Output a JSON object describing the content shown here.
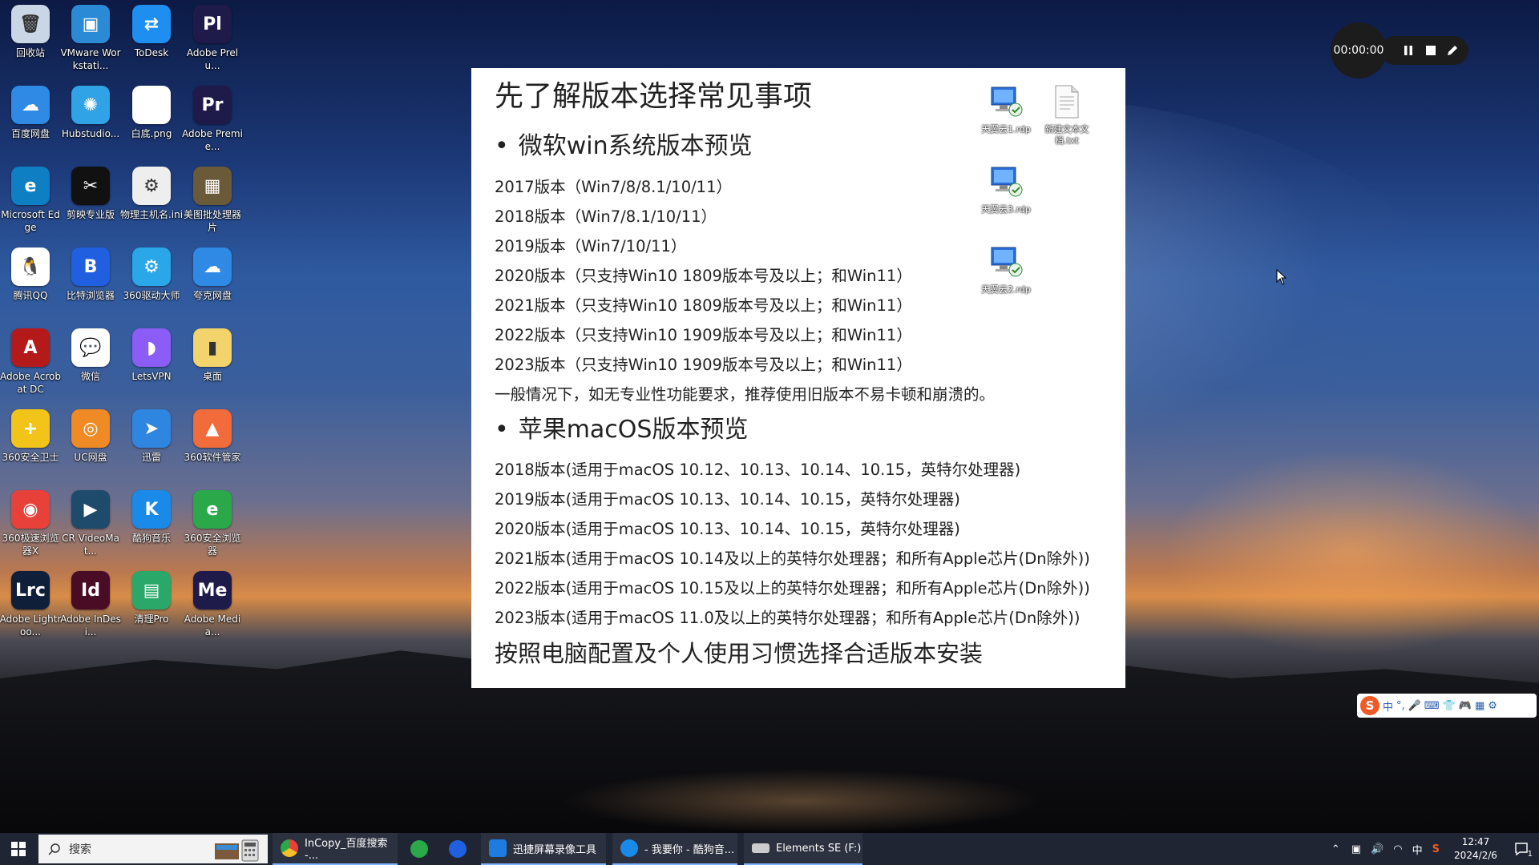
{
  "desktop_icons": [
    {
      "label": "回收站",
      "icon": "recycle-bin-icon",
      "color": "#c9d6e6",
      "glyph": "🗑"
    },
    {
      "label": "VMware Workstati...",
      "icon": "vmware-icon",
      "color": "#2b8ad6",
      "glyph": "▣"
    },
    {
      "label": "ToDesk",
      "icon": "todesk-icon",
      "color": "#1f8ef1",
      "glyph": "⇄"
    },
    {
      "label": "Adobe Prelu...",
      "icon": "adobe-prelude-icon",
      "color": "#1e1b4b",
      "glyph": "Pl"
    },
    {
      "label": "百度网盘",
      "icon": "baidu-netdisk-icon",
      "color": "#2f8ae5",
      "glyph": "☁"
    },
    {
      "label": "Hubstudio...",
      "icon": "hubstudio-icon",
      "color": "#2fa3e6",
      "glyph": "✺"
    },
    {
      "label": "白底.png",
      "icon": "image-file-icon",
      "color": "#ffffff",
      "glyph": ""
    },
    {
      "label": "Adobe Premie...",
      "icon": "adobe-premiere-icon",
      "color": "#1e1b4b",
      "glyph": "Pr"
    },
    {
      "label": "Microsoft Edge",
      "icon": "edge-icon",
      "color": "#0f7fc4",
      "glyph": "e"
    },
    {
      "label": "剪映专业版",
      "icon": "jianying-icon",
      "color": "#111111",
      "glyph": "✂"
    },
    {
      "label": "物理主机名.ini",
      "icon": "ini-file-icon",
      "color": "#eeeeee",
      "glyph": "⚙"
    },
    {
      "label": "美图批处理器片",
      "icon": "meitu-icon",
      "color": "#6b5a3a",
      "glyph": "▦"
    },
    {
      "label": "腾讯QQ",
      "icon": "qq-icon",
      "color": "#ffffff",
      "glyph": "🐧"
    },
    {
      "label": "比特浏览器",
      "icon": "bit-browser-icon",
      "color": "#1f5fe0",
      "glyph": "B"
    },
    {
      "label": "360驱动大师",
      "icon": "driver-master-icon",
      "color": "#2aa7e8",
      "glyph": "⚙"
    },
    {
      "label": "夸克网盘",
      "icon": "quark-netdisk-icon",
      "color": "#2f8ae5",
      "glyph": "☁"
    },
    {
      "label": "Adobe Acrobat DC",
      "icon": "acrobat-icon",
      "color": "#b51a1a",
      "glyph": "A"
    },
    {
      "label": "微信",
      "icon": "wechat-icon",
      "color": "#ffffff",
      "glyph": "💬"
    },
    {
      "label": "LetsVPN",
      "icon": "letsvpn-icon",
      "color": "#8b5cf6",
      "glyph": "◗"
    },
    {
      "label": "桌面",
      "icon": "folder-icon",
      "color": "#f3d36b",
      "glyph": "▮"
    },
    {
      "label": "360安全卫士",
      "icon": "360-security-icon",
      "color": "#f2c41a",
      "glyph": "+"
    },
    {
      "label": "UC网盘",
      "icon": "uc-netdisk-icon",
      "color": "#f08a24",
      "glyph": "◎"
    },
    {
      "label": "迅雷",
      "icon": "xunlei-icon",
      "color": "#2f86e0",
      "glyph": "➤"
    },
    {
      "label": "360软件管家",
      "icon": "360-software-icon",
      "color": "#f26b3a",
      "glyph": "▲"
    },
    {
      "label": "360极速浏览器X",
      "icon": "360-browser-icon",
      "color": "#e8413a",
      "glyph": "◉"
    },
    {
      "label": "CR VideoMat...",
      "icon": "cr-videomate-icon",
      "color": "#1e4a6b",
      "glyph": "▶"
    },
    {
      "label": "酷狗音乐",
      "icon": "kugou-icon",
      "color": "#1a8ae8",
      "glyph": "K"
    },
    {
      "label": "360安全浏览器",
      "icon": "360-safe-browser-icon",
      "color": "#2aa84a",
      "glyph": "e"
    },
    {
      "label": "Adobe Lightroo...",
      "icon": "lightroom-icon",
      "color": "#0f1f3a",
      "glyph": "Lrc"
    },
    {
      "label": "Adobe InDesi...",
      "icon": "indesign-icon",
      "color": "#4a0b24",
      "glyph": "Id"
    },
    {
      "label": "清理Pro",
      "icon": "cleaner-pro-icon",
      "color": "#2aa86a",
      "glyph": "▤"
    },
    {
      "label": "Adobe Media...",
      "icon": "media-encoder-icon",
      "color": "#1e1b4b",
      "glyph": "Me"
    }
  ],
  "slide": {
    "title": "先了解版本选择常见事项",
    "section_win": "微软win系统版本预览",
    "win_lines": [
      "2017版本（Win7/8/8.1/10/11）",
      "2018版本（Win7/8.1/10/11）",
      "2019版本（Win7/10/11）",
      "2020版本（只支持Win10 1809版本号及以上；和Win11）",
      "2021版本（只支持Win10 1809版本号及以上；和Win11）",
      "2022版本（只支持Win10 1909版本号及以上；和Win11）",
      "2023版本（只支持Win10 1909版本号及以上；和Win11）"
    ],
    "note": "一般情况下，如无专业性功能要求，推荐使用旧版本不易卡顿和崩溃的。",
    "section_mac": "苹果macOS版本预览",
    "mac_lines": [
      "2018版本(适用于macOS 10.12、10.13、10.14、10.15，英特尔处理器)",
      "2019版本(适用于macOS 10.13、10.14、10.15，英特尔处理器)",
      "2020版本(适用于macOS 10.13、10.14、10.15，英特尔处理器)",
      "2021版本(适用于macOS 10.14及以上的英特尔处理器；和所有Apple芯片(Dn除外))",
      "2022版本(适用于macOS 10.15及以上的英特尔处理器；和所有Apple芯片(Dn除外))",
      "2023版本(适用于macOS 11.0及以上的英特尔处理器；和所有Apple芯片(Dn除外))"
    ],
    "footer": "按照电脑配置及个人使用习惯选择合适版本安装",
    "bullet": "•"
  },
  "slide_icons": [
    {
      "label": "天翼云1.rdp",
      "icon": "rdp-file-icon"
    },
    {
      "label": "新建文本文档.txt",
      "icon": "text-file-icon"
    },
    {
      "label": "天翼云3.rdp",
      "icon": "rdp-file-icon"
    },
    {
      "label": "天翼云2.rdp",
      "icon": "rdp-file-icon"
    }
  ],
  "recorder": {
    "time": "00:00:00"
  },
  "ime": {
    "mode": "中"
  },
  "taskbar": {
    "search_placeholder": "搜索",
    "items": [
      {
        "label": "InCopy_百度搜索 -...",
        "icon": "chrome-icon",
        "color": "#e8413a"
      },
      {
        "label": "迅捷屏幕录像工具",
        "icon": "screen-recorder-icon",
        "color": "#1e7be0"
      },
      {
        "label": "- 我要你 - 酷狗音...",
        "icon": "kugou-icon",
        "color": "#1a8ae8"
      },
      {
        "label": "Elements SE (F:)",
        "icon": "drive-icon",
        "color": "#cccccc"
      }
    ],
    "tray_lang": "中",
    "time": "12:47",
    "date": "2024/2/6",
    "notification_count": "1"
  }
}
